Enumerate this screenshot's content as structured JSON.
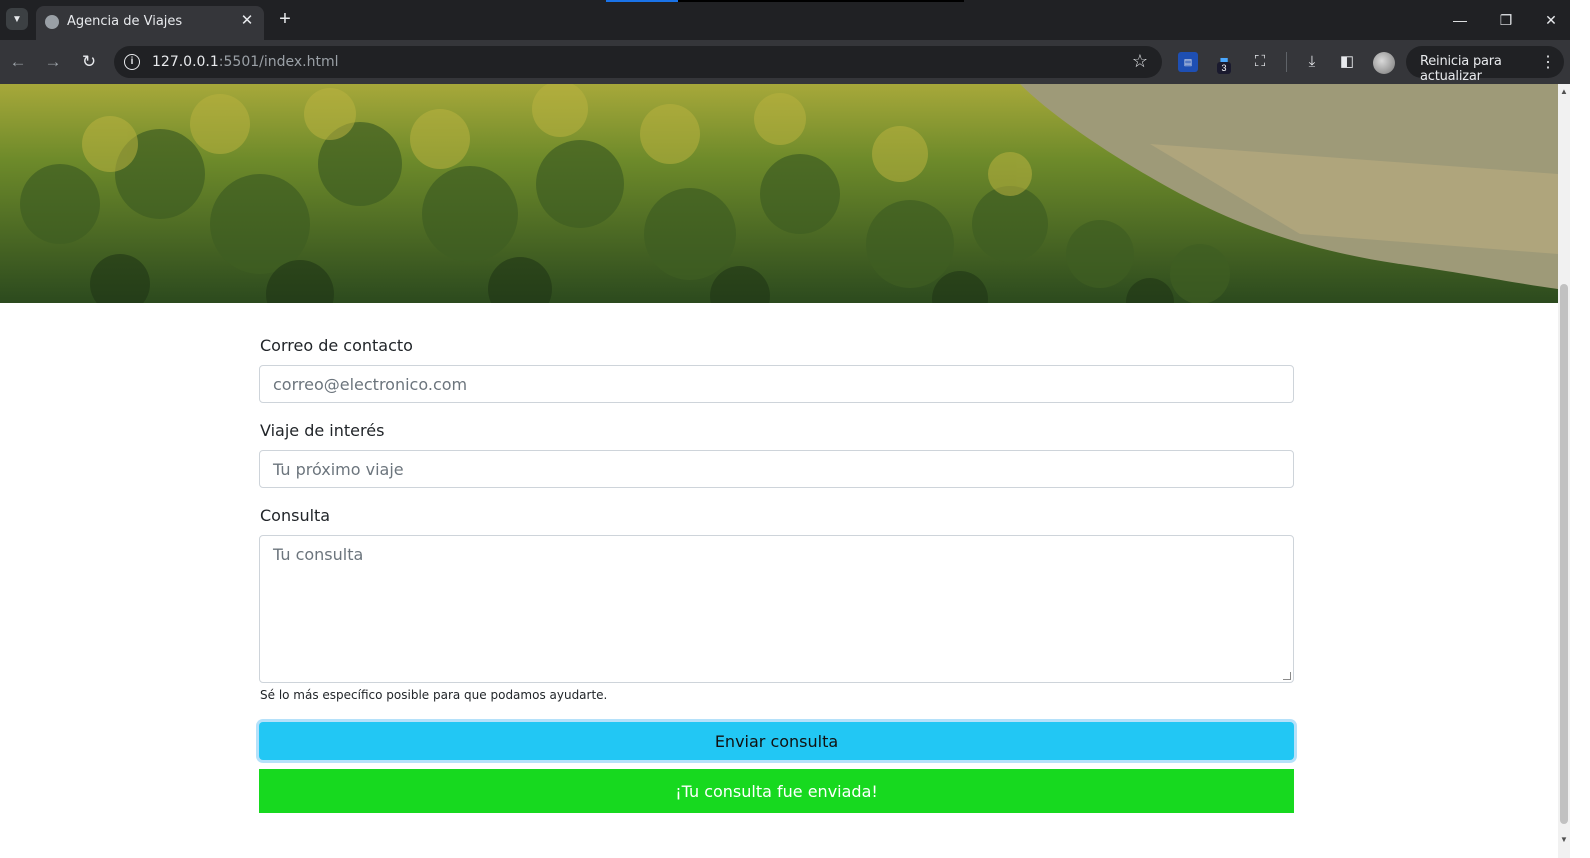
{
  "browser": {
    "tab_title": "Agencia de Viajes",
    "url_host": "127.0.0.1",
    "url_rest": ":5501/index.html",
    "extension_badge": "3",
    "update_button": "Reinicia para actualizar",
    "window_controls": [
      "minimize-icon",
      "restore-icon",
      "close-icon"
    ]
  },
  "form": {
    "email_label": "Correo de contacto",
    "email_placeholder": "correo@electronico.com",
    "trip_label": "Viaje de interés",
    "trip_placeholder": "Tu próximo viaje",
    "query_label": "Consulta",
    "query_placeholder": "Tu consulta",
    "help_text": "Sé lo más específico posible para que podamos ayudarte.",
    "submit_label": "Enviar consulta",
    "success_message": "¡Tu consulta fue enviada!"
  },
  "colors": {
    "submit_bg": "#22c7f4",
    "success_bg": "#17d91f",
    "chrome_dark": "#202124",
    "loading_bar": "#1a73e8"
  }
}
